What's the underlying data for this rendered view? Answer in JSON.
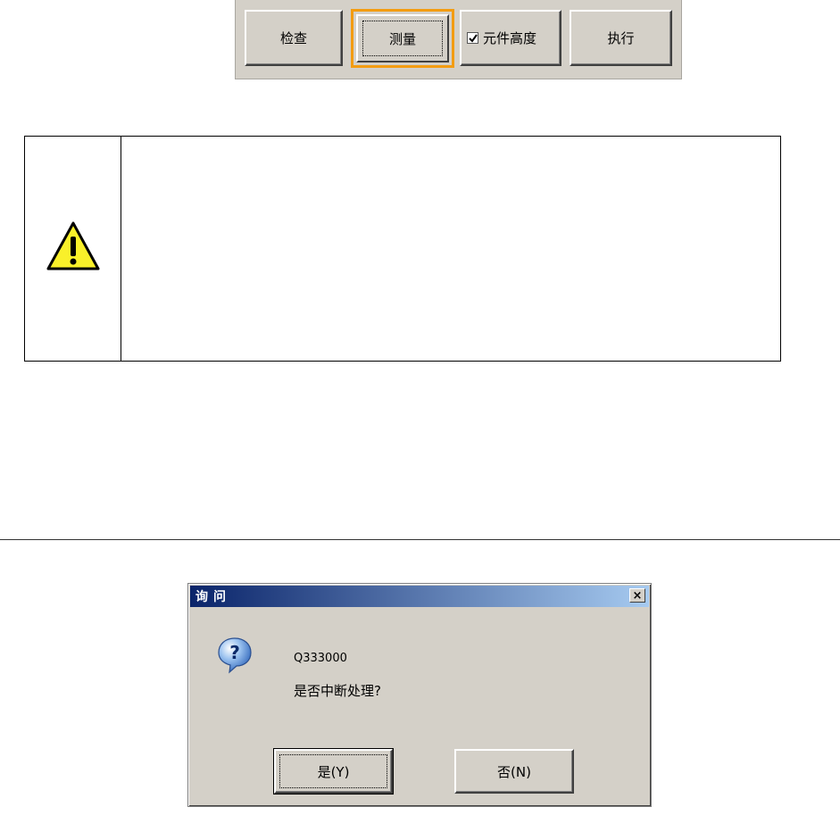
{
  "toolbar": {
    "check_label": "检查",
    "measure_label": "测量",
    "component_height_label": "元件高度",
    "component_height_checked": true,
    "execute_label": "执行"
  },
  "warning": {
    "icon": "warning-triangle-icon",
    "content": ""
  },
  "dialog": {
    "title": "询问",
    "close_label": "×",
    "icon": "question-bubble-icon",
    "message_code": "Q333000",
    "message": "是否中断处理?",
    "yes_label": "是(Y)",
    "no_label": "否(N)"
  },
  "colors": {
    "face": "#d4d0c8",
    "focus_outline": "#f39c12",
    "titlebar_start": "#0a246a",
    "titlebar_end": "#a6caf0",
    "warning_yellow": "#f9f02a"
  }
}
